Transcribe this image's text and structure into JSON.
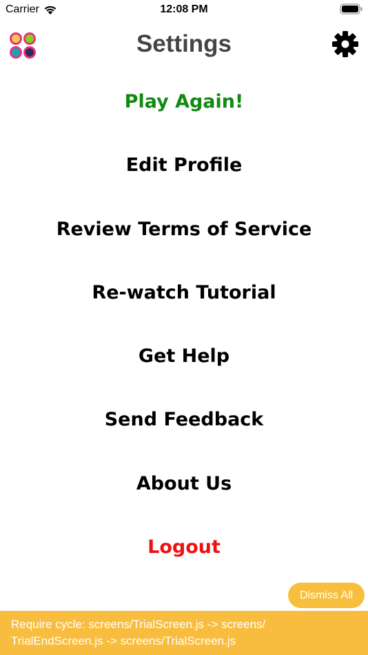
{
  "status_bar": {
    "carrier": "Carrier",
    "time": "12:08 PM",
    "wifi_icon": "wifi-icon",
    "battery_icon": "battery-icon"
  },
  "header": {
    "title": "Settings",
    "logo_icon": "app-logo-icon",
    "settings_icon": "gear-icon"
  },
  "menu": {
    "items": [
      {
        "label": "Play Again!",
        "color": "#118a11"
      },
      {
        "label": "Edit Profile",
        "color": "#000000"
      },
      {
        "label": "Review Terms of Service",
        "color": "#000000"
      },
      {
        "label": "Re-watch Tutorial",
        "color": "#000000"
      },
      {
        "label": "Get Help",
        "color": "#000000"
      },
      {
        "label": "Send Feedback",
        "color": "#000000"
      },
      {
        "label": "About Us",
        "color": "#000000"
      },
      {
        "label": "Logout",
        "color": "#ee1111"
      }
    ]
  },
  "dismiss": {
    "label": "Dismiss All"
  },
  "warning": {
    "line1": "Require cycle: screens/TrialScreen.js -> screens/",
    "line2": "TrialEndScreen.js -> screens/TrialScreen.js",
    "color": "#f8bd3e"
  },
  "colors": {
    "title": "#444444",
    "accent_yellow": "#f7bf3d"
  }
}
